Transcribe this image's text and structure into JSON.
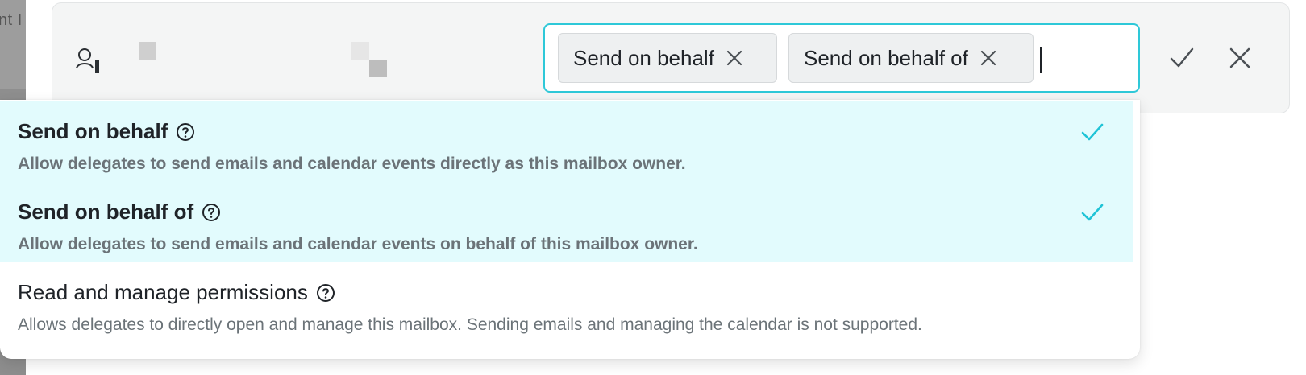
{
  "background": {
    "partial_text": "nt I"
  },
  "row": {
    "user_icon": "user-icon",
    "tags": [
      {
        "label": "Send on behalf",
        "remove_icon": "close-icon"
      },
      {
        "label": "Send on behalf of",
        "remove_icon": "close-icon"
      }
    ],
    "confirm_icon": "checkmark-icon",
    "cancel_icon": "close-icon"
  },
  "dropdown": {
    "options": [
      {
        "title": "Send on behalf",
        "description": "Allow delegates to send emails and calendar events directly as this mailbox owner.",
        "selected": true
      },
      {
        "title": "Send on behalf of",
        "description": "Allow delegates to send emails and calendar events on behalf of this mailbox owner.",
        "selected": true
      },
      {
        "title": "Read and manage permissions",
        "description": "Allows delegates to directly open and manage this mailbox. Sending emails and managing the calendar is not supported.",
        "selected": false
      }
    ]
  },
  "colors": {
    "accent": "#2ec8d8",
    "selected_bg": "#e2fbfd",
    "check": "#1fc3d6"
  }
}
